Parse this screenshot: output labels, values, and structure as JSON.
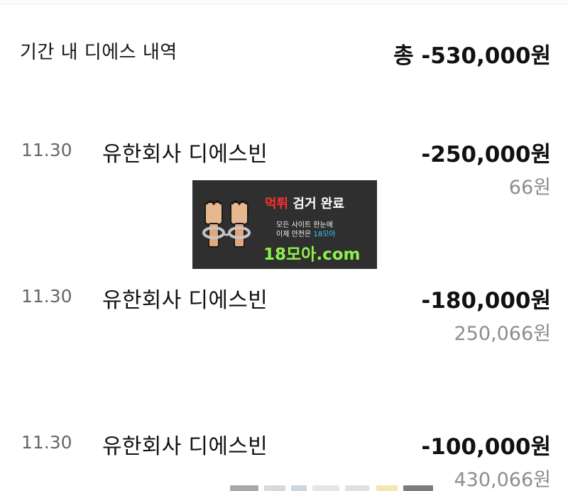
{
  "summary": {
    "label": "기간 내 디에스 내역",
    "total": "총 -530,000원"
  },
  "transactions": [
    {
      "date": "11.30",
      "merchant": "유한회사 디에스빈",
      "amount": "-250,000원",
      "balance": "66원"
    },
    {
      "date": "11.30",
      "merchant": "유한회사 디에스빈",
      "amount": "-180,000원",
      "balance": "250,066원"
    },
    {
      "date": "11.30",
      "merchant": "유한회사 디에스빈",
      "amount": "-100,000원",
      "balance": "430,066원"
    }
  ],
  "banner": {
    "headline_red": "먹튀",
    "headline_white": " 검거 완료",
    "line1": "모든 사이트 한눈에",
    "line2_prefix": "이제 안전은 ",
    "line2_accent": "18모아",
    "domain": "18모아.com"
  },
  "colors": {
    "primary_text": "#111111",
    "secondary_text": "#666666",
    "balance_text": "#8d8d8d",
    "divider": "#ececec",
    "banner_bg": "#2f2f2f",
    "banner_red": "#ff2f2f",
    "banner_blue": "#39c7ff",
    "banner_green": "#8ef14b"
  },
  "icons": [
    "fist-handcuff-icon"
  ]
}
